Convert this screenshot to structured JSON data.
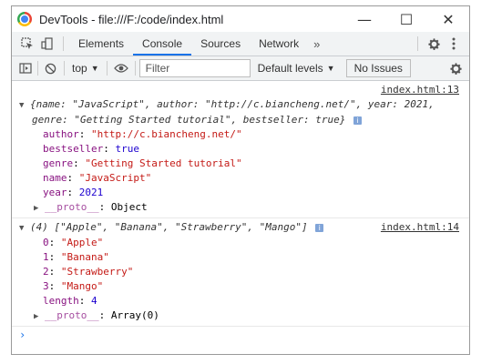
{
  "window": {
    "title": "DevTools - file:///F:/code/index.html",
    "buttons": {
      "minimize": "—",
      "maximize": "☐",
      "close": "✕"
    }
  },
  "tabs": [
    "Elements",
    "Console",
    "Sources",
    "Network"
  ],
  "more_tabs": "»",
  "toolbar": {
    "context": "top",
    "filter_placeholder": "Filter",
    "levels": "Default levels",
    "no_issues": "No Issues"
  },
  "messages": [
    {
      "source": "index.html:13",
      "summary_line1": "{name: \"JavaScript\", author: \"http://c.biancheng.net/\", year: 2021,",
      "summary_line2": "genre: \"Getting Started tutorial\", bestseller: true}",
      "props": [
        {
          "key": "author",
          "value": "\"http://c.biancheng.net/\"",
          "type": "str"
        },
        {
          "key": "bestseller",
          "value": "true",
          "type": "bool"
        },
        {
          "key": "genre",
          "value": "\"Getting Started tutorial\"",
          "type": "str"
        },
        {
          "key": "name",
          "value": "\"JavaScript\"",
          "type": "str"
        },
        {
          "key": "year",
          "value": "2021",
          "type": "num"
        }
      ],
      "proto_key": "__proto__",
      "proto_value": "Object"
    },
    {
      "source": "index.html:14",
      "summary": "(4) [\"Apple\", \"Banana\", \"Strawberry\", \"Mango\"]",
      "props": [
        {
          "key": "0",
          "value": "\"Apple\"",
          "type": "str"
        },
        {
          "key": "1",
          "value": "\"Banana\"",
          "type": "str"
        },
        {
          "key": "2",
          "value": "\"Strawberry\"",
          "type": "str"
        },
        {
          "key": "3",
          "value": "\"Mango\"",
          "type": "str"
        },
        {
          "key": "length",
          "value": "4",
          "type": "num"
        }
      ],
      "proto_key": "__proto__",
      "proto_value": "Array(0)"
    }
  ],
  "prompt": "›"
}
